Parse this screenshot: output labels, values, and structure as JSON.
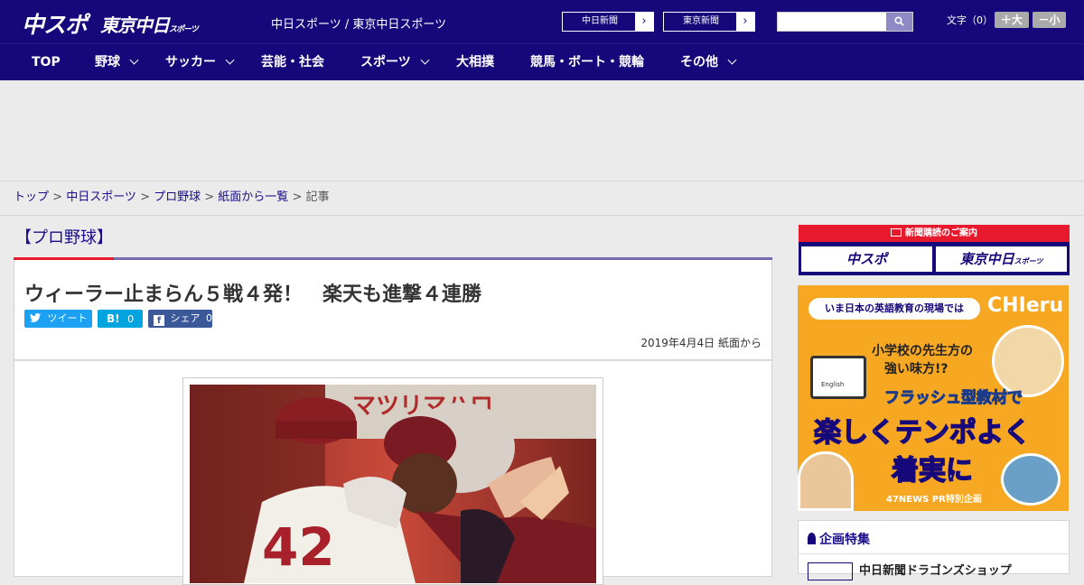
{
  "header": {
    "logo_primary": "中スポ",
    "logo_secondary": "東京中日",
    "logo_secondary_small": "スポーツ",
    "site_label": "中日スポーツ / 東京中日スポーツ",
    "paper_links": [
      {
        "label": "中日新聞"
      },
      {
        "label": "東京新聞"
      }
    ],
    "search": {
      "placeholder": "",
      "button_icon": "search-icon"
    },
    "font_size_label": "文字（0）",
    "font_plus": "＋大",
    "font_minus": "－小"
  },
  "nav": {
    "items": [
      {
        "label": "TOP",
        "dropdown": false
      },
      {
        "label": "野球",
        "dropdown": true
      },
      {
        "label": "サッカー",
        "dropdown": true
      },
      {
        "label": "芸能・社会",
        "dropdown": false
      },
      {
        "label": "スポーツ",
        "dropdown": true
      },
      {
        "label": "大相撲",
        "dropdown": false
      },
      {
        "label": "競馬・ボート・競輪",
        "dropdown": false
      },
      {
        "label": "その他",
        "dropdown": true
      }
    ]
  },
  "breadcrumb": {
    "items": [
      "トップ",
      "中日スポーツ",
      "プロ野球",
      "紙面から一覧"
    ],
    "current": "記事",
    "sep": " > "
  },
  "section": {
    "title": "【プロ野球】"
  },
  "article": {
    "headline": "ウィーラー止まらん５戦４発！　楽天も進撃４連勝",
    "share": {
      "tweet": "ツイート",
      "hatena_label": "B!",
      "hatena_count": "0",
      "facebook_label": "シェア",
      "facebook_count": "0"
    },
    "date": "2019年4月4日 紙面から"
  },
  "sidebar": {
    "subscribe_header": "新聞購読のご案内",
    "subscribe_links": [
      "中スポ",
      "東京中日"
    ],
    "subscribe_small": "スポーツ",
    "ad": {
      "top": "いま日本の英語教育の現場では",
      "brand": "CHIeru",
      "line1": "小学校の先生方の",
      "line2": "強い味方!?",
      "line3": "フラッシュ型教材で",
      "line4": "楽しくテンポよく",
      "line5": "着実に",
      "footer": "47NEWS PR特別企画",
      "screen_text": "English"
    },
    "kikaku_title": "企画特集",
    "kikaku_item": "中日新聞ドラゴンズショップ"
  },
  "photo_content": {
    "jersey_number": "42",
    "signboard": "マツリマハロ"
  },
  "colors": {
    "brand_navy": "#16087a",
    "accent_red": "#e8192c",
    "twitter": "#1da1f2",
    "hatena": "#00a4de",
    "facebook": "#3b5998",
    "ad_orange": "#f7a823"
  }
}
